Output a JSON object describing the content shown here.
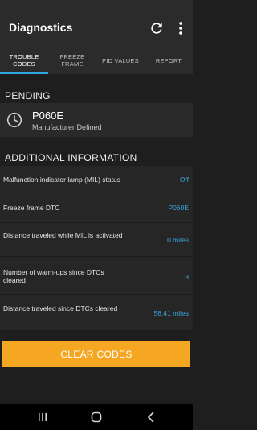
{
  "appbar": {
    "title": "Diagnostics",
    "icons": [
      "refresh-icon",
      "more-vert-icon"
    ]
  },
  "tabs": [
    {
      "label": "TROUBLE CODES",
      "line1": "TROUBLE",
      "line2": "CODES",
      "active": true
    },
    {
      "label": "FREEZE FRAME",
      "line1": "FREEZE",
      "line2": "FRAME",
      "active": false
    },
    {
      "label": "PID VALUES",
      "line1": "PID VALUES",
      "line2": "",
      "active": false
    },
    {
      "label": "REPORT",
      "line1": "REPORT",
      "line2": "",
      "active": false
    }
  ],
  "pending": {
    "header": "PENDING",
    "code": "P060E",
    "description": "Manufacturer Defined",
    "icon": "clock-icon"
  },
  "additional": {
    "header": "ADDITIONAL INFORMATION",
    "rows": [
      {
        "label": "Malfunction indicator lamp (MIL) status",
        "value": "Off"
      },
      {
        "label": "Freeze frame DTC",
        "value": "P060E"
      },
      {
        "label": "Distance traveled while MIL is activated",
        "value": "0 miles"
      },
      {
        "label": "Number of warm-ups since DTCs cleared",
        "value": "3"
      },
      {
        "label": "Distance traveled since DTCs cleared",
        "value": "58,41 miles"
      }
    ]
  },
  "actions": {
    "clear_codes": "CLEAR CODES"
  },
  "navbar": {
    "icons": [
      "recents-icon",
      "home-icon",
      "back-icon"
    ]
  },
  "colors": {
    "accent": "#2ea8e0",
    "value_text": "#3aa6dd",
    "button": "#f5a623",
    "background": "#1e1e1e"
  }
}
